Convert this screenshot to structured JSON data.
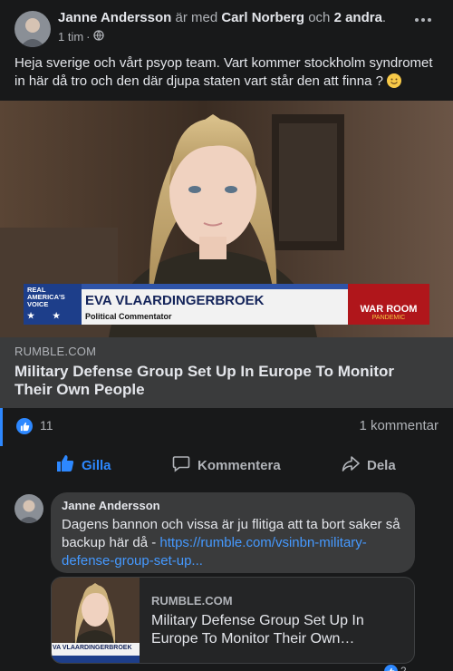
{
  "post": {
    "author": "Janne Andersson",
    "with_text": "är med",
    "tagged": "Carl Norberg",
    "and_text": "och",
    "others": "2 andra",
    "period": ".",
    "time": "1 tim",
    "separator": "·",
    "audience_icon": "globe-icon",
    "text": "Heja sverige och vårt psyop team. Vart kommer stockholm syndromet in här då tro och den där djupa staten vart står den att finna ?"
  },
  "preview": {
    "banner": {
      "network_line1": "REAL",
      "network_line2": "AMERICA'S",
      "network_line3": "VOICE",
      "name": "EVA VLAARDINGERBROEK",
      "role": "Political Commentator",
      "show_name": "WAR ROOM",
      "show_sub": "PANDEMIC"
    },
    "domain": "RUMBLE.COM",
    "title": "Military Defense Group Set Up In Europe To Monitor Their Own People"
  },
  "counts": {
    "likes": "11",
    "comments": "1 kommentar"
  },
  "actions": {
    "like": "Gilla",
    "comment": "Kommentera",
    "share": "Dela"
  },
  "comment": {
    "author": "Janne Andersson",
    "text": "Dagens bannon och vissa är ju flitiga att ta bort saker så backup här då -",
    "link": "https://rumble.com/vsinbn-military-defense-group-set-up...",
    "card": {
      "thumb_banner": "VA VLAARDINGERBROEK",
      "domain": "RUMBLE.COM",
      "title": "Military Defense Group Set Up In Europe To Monitor Their Own…"
    },
    "reactions": "2"
  },
  "colors": {
    "background": "#18191a",
    "card": "#3a3b3c",
    "accent": "#2d88ff",
    "text": "#e4e6eb",
    "muted": "#b0b3b8"
  }
}
